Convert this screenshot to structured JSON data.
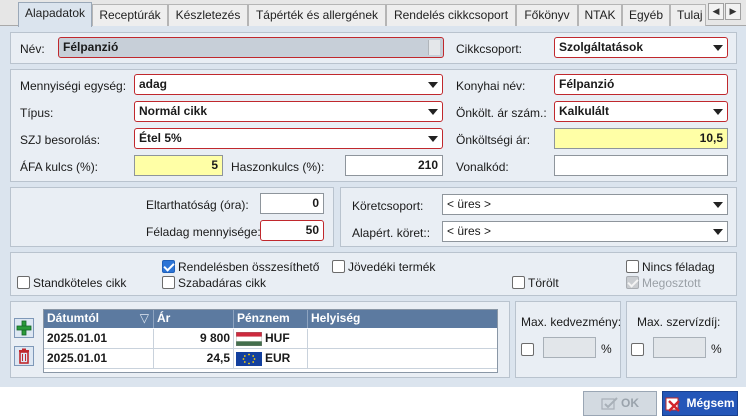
{
  "tabs": [
    {
      "label": "Alapadatok",
      "active": true
    },
    {
      "label": "Receptúrák"
    },
    {
      "label": "Készletezés"
    },
    {
      "label": "Tápérték és allergének"
    },
    {
      "label": "Rendelés cikkcsoport"
    },
    {
      "label": "Főkönyv"
    },
    {
      "label": "NTAK"
    },
    {
      "label": "Egyéb"
    },
    {
      "label": "Tulaj"
    }
  ],
  "tab_nav": {
    "prev": "◀",
    "next": "▶"
  },
  "name": {
    "label": "Név:",
    "value": "Félpanzió"
  },
  "group": {
    "label": "Cikkcsoport:",
    "value": "Szolgáltatások"
  },
  "unit": {
    "label": "Mennyiségi egység:",
    "value": "adag"
  },
  "kitchen_name": {
    "label": "Konyhai név:",
    "value": "Félpanzió"
  },
  "type": {
    "label": "Típus:",
    "value": "Normál cikk"
  },
  "cost_calc": {
    "label": "Önkölt. ár szám.:",
    "value": "Kalkulált"
  },
  "szj": {
    "label": "SZJ besorolás:",
    "value": "Étel 5%"
  },
  "cost_price": {
    "label": "Önköltségi ár:",
    "value": "10,5"
  },
  "vat": {
    "label": "ÁFA kulcs (%):",
    "value": "5"
  },
  "margin": {
    "label": "Haszonkulcs (%):",
    "value": "210"
  },
  "barcode": {
    "label": "Vonalkód:",
    "value": ""
  },
  "shelf_life": {
    "label": "Eltarthatóság (óra):",
    "value": "0"
  },
  "portion_qty": {
    "label": "Féladag mennyisége:",
    "value": "50"
  },
  "side_group": {
    "label": "Köretcsoport:",
    "value": "< üres >"
  },
  "default_side": {
    "label": "Alapért. köret::",
    "value": "< üres >"
  },
  "checkboxes": {
    "standard": {
      "label": "Standköteles cikk",
      "checked": false
    },
    "summarize": {
      "label": "Rendelésben összesíthető",
      "checked": true
    },
    "free_price": {
      "label": "Szabadáras cikk",
      "checked": false
    },
    "excise": {
      "label": "Jövedéki termék",
      "checked": false
    },
    "deleted": {
      "label": "Törölt",
      "checked": false
    },
    "no_half": {
      "label": "Nincs féladag",
      "checked": false
    },
    "shared": {
      "label": "Megosztott",
      "checked": true,
      "disabled": true
    }
  },
  "price_grid": {
    "columns": [
      "Dátumtól",
      "Ár",
      "Pénznem",
      "Helyiség"
    ],
    "sort_glyph": "▽",
    "rows": [
      {
        "date": "2025.01.01",
        "price": "9 800",
        "currency": "HUF",
        "flag": "hu-flag",
        "place": ""
      },
      {
        "date": "2025.01.01",
        "price": "24,5",
        "currency": "EUR",
        "flag": "eu-flag",
        "place": ""
      }
    ]
  },
  "max_discount": {
    "label": "Max. kedvezmény:",
    "unit": "%",
    "value": ""
  },
  "max_service": {
    "label": "Max. szervízdíj:",
    "unit": "%",
    "value": ""
  },
  "buttons": {
    "ok": "OK",
    "cancel": "Mégsem"
  },
  "colors": {
    "accent_red": "#c0282d",
    "header_blue": "#5c7aa0",
    "highlight_yellow": "#ffffa6",
    "panel_bg": "#dbe4ee"
  }
}
